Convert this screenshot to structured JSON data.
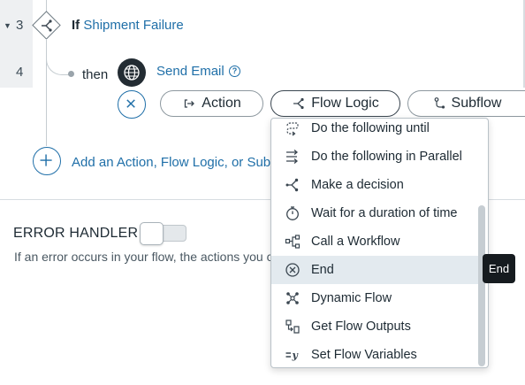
{
  "flow": {
    "row3_number": "3",
    "row4_number": "4",
    "if_keyword": "If",
    "if_condition": "Shipment Failure",
    "then_label": "then",
    "action_name": "Send Email",
    "help_glyph": "?"
  },
  "add_step_buttons": {
    "action_label": "Action",
    "flow_logic_label": "Flow Logic",
    "subflow_label": "Subflow"
  },
  "add_link": "Add an Action, Flow Logic, or Subflow",
  "error_handler": {
    "title": "ERROR HANDLER",
    "enabled": false,
    "description": "If an error occurs in your flow, the actions you configure here will run."
  },
  "flow_logic_menu": {
    "items": [
      {
        "label": "Do the following until",
        "icon": "loop-until-icon"
      },
      {
        "label": "Do the following in Parallel",
        "icon": "parallel-icon"
      },
      {
        "label": "Make a decision",
        "icon": "decision-icon"
      },
      {
        "label": "Wait for a duration of time",
        "icon": "timer-icon"
      },
      {
        "label": "Call a Workflow",
        "icon": "workflow-icon"
      },
      {
        "label": "End",
        "icon": "end-icon",
        "selected": true
      },
      {
        "label": "Dynamic Flow",
        "icon": "dynamic-flow-icon"
      },
      {
        "label": "Get Flow Outputs",
        "icon": "flow-outputs-icon"
      },
      {
        "label": "Set Flow Variables",
        "icon": "set-variables-icon"
      }
    ]
  },
  "tooltip": "End",
  "colors": {
    "link": "#1f6fa8",
    "text": "#1d2a33",
    "selected_bg": "#e3eaef",
    "tooltip_bg": "#161b1f"
  }
}
